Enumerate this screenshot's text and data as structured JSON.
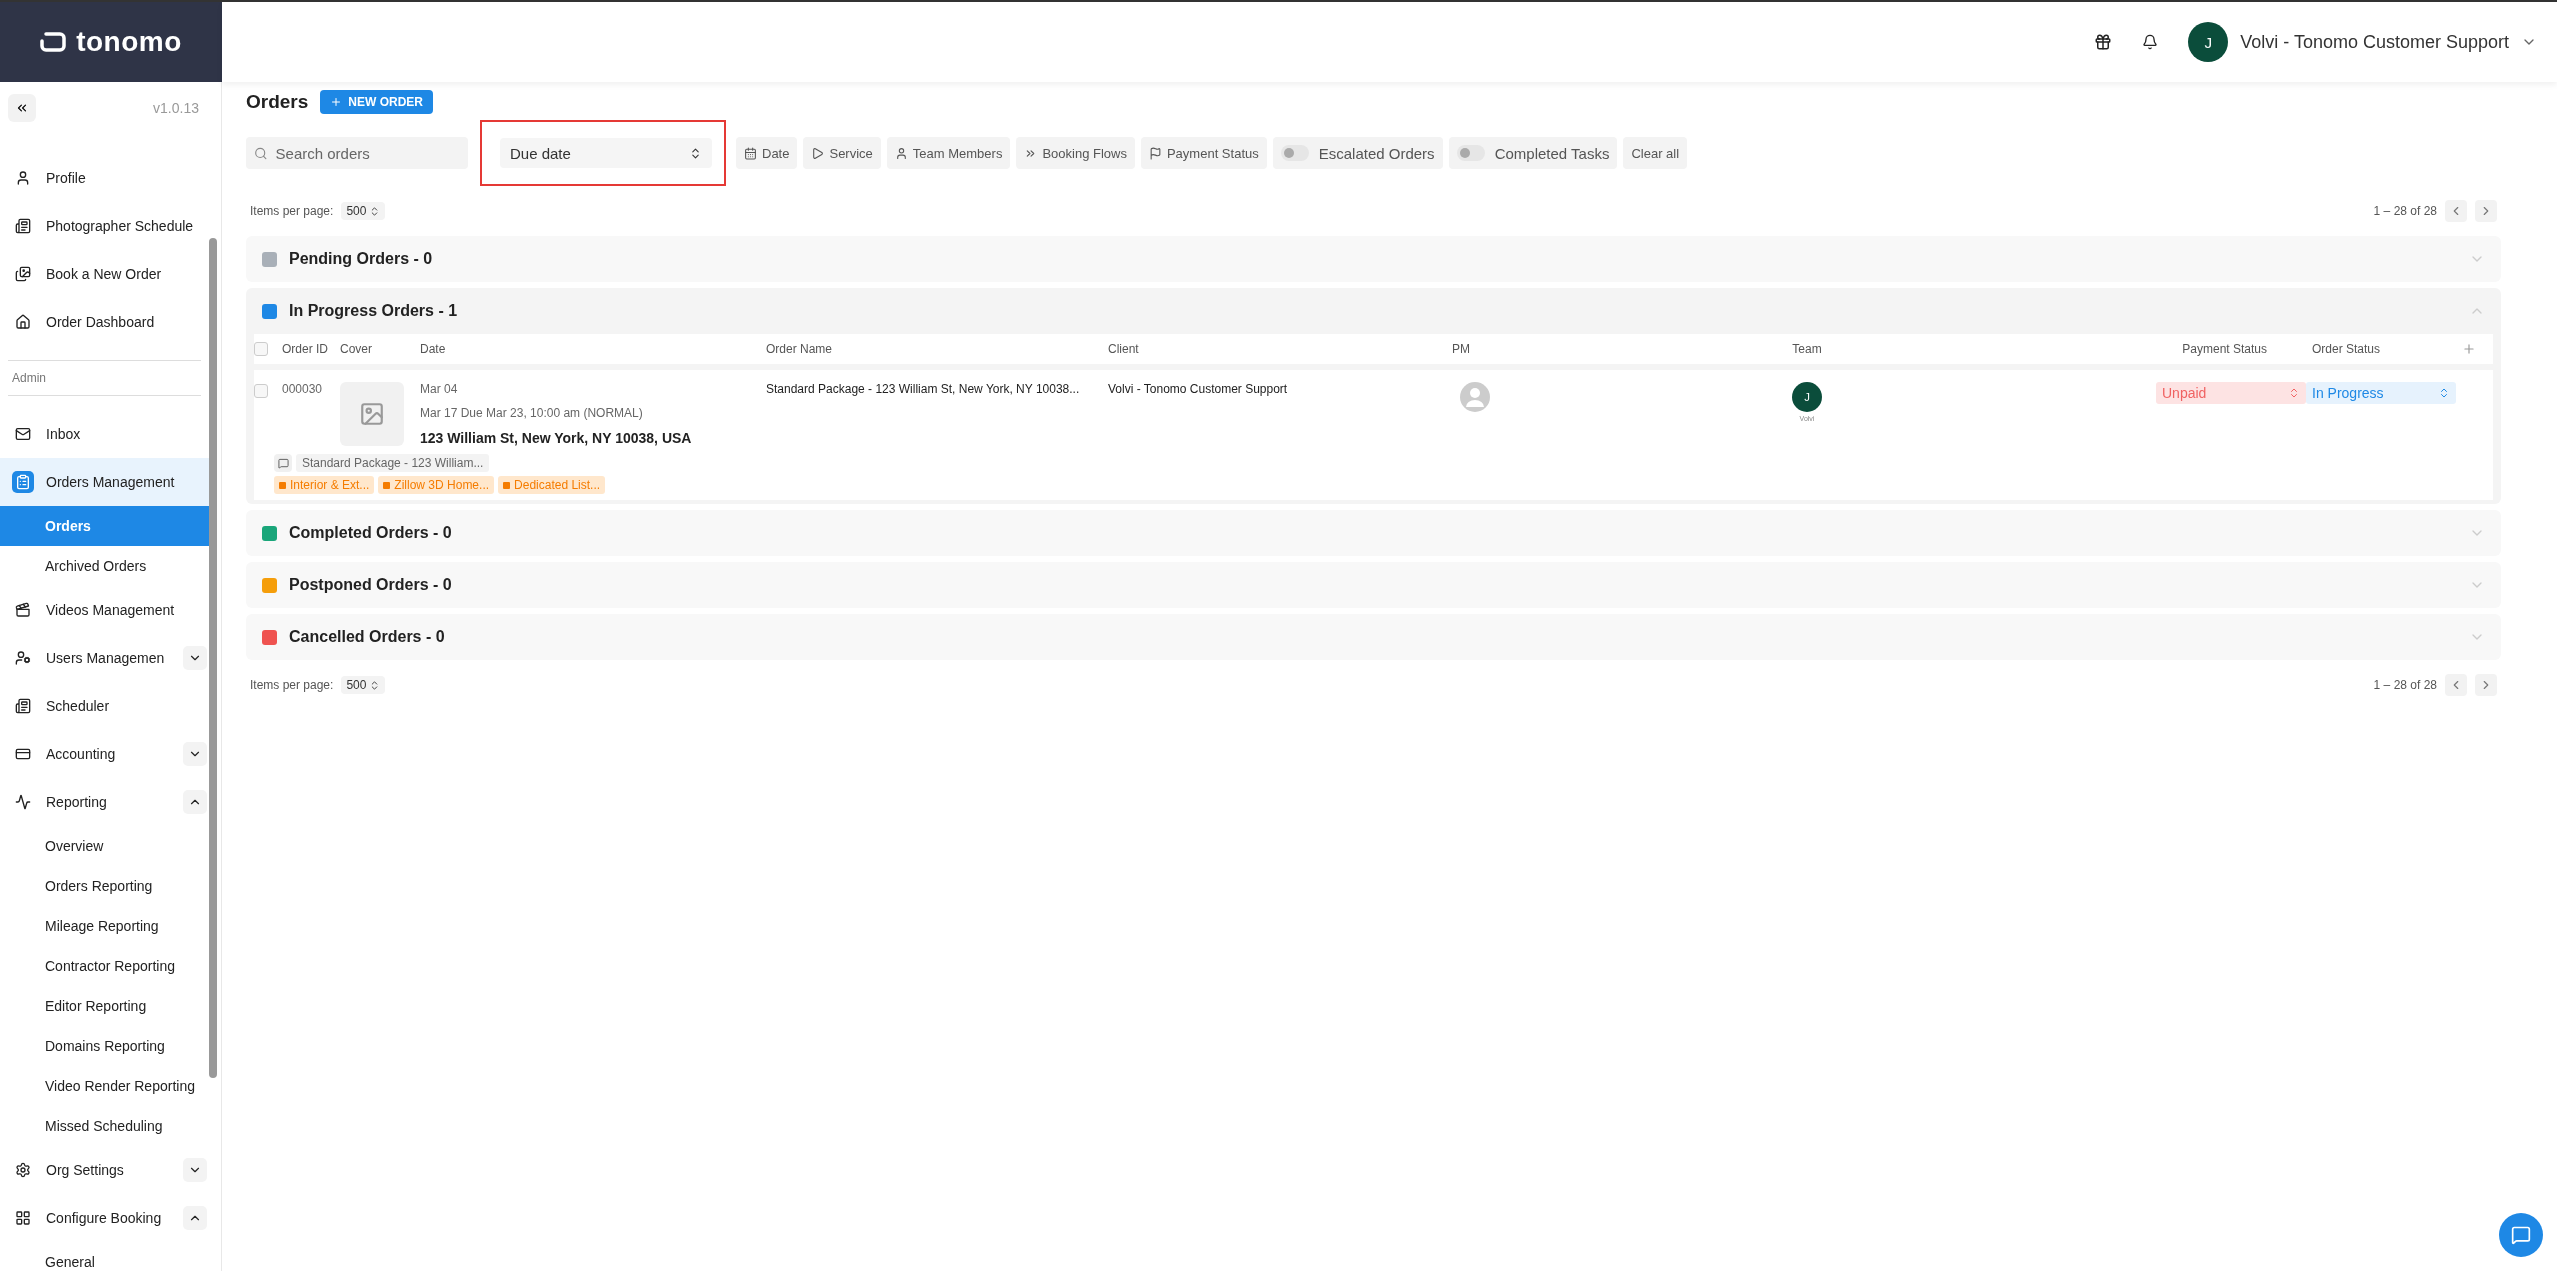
{
  "brand": {
    "name": "tonomo"
  },
  "header": {
    "user_initial": "J",
    "user_name": "Volvi - Tonomo Customer Support"
  },
  "sidebar": {
    "version": "v1.0.13",
    "items": [
      {
        "kind": "item",
        "label": "Profile",
        "selected": false
      },
      {
        "kind": "item",
        "label": "Photographer Schedule",
        "selected": false
      },
      {
        "kind": "item",
        "label": "Book a New Order",
        "selected": false
      },
      {
        "kind": "item",
        "label": "Order Dashboard",
        "selected": false
      },
      {
        "kind": "section",
        "label": "Admin"
      },
      {
        "kind": "item",
        "label": "Inbox",
        "selected": false
      },
      {
        "kind": "item",
        "label": "Orders Management",
        "selected": true,
        "children": [
          {
            "label": "Orders",
            "selected": true
          },
          {
            "label": "Archived Orders",
            "selected": false
          }
        ]
      },
      {
        "kind": "item",
        "label": "Videos Management",
        "selected": false
      },
      {
        "kind": "item",
        "label": "Users Managemen",
        "selected": false,
        "expanded": false
      },
      {
        "kind": "item",
        "label": "Scheduler",
        "selected": false
      },
      {
        "kind": "item",
        "label": "Accounting",
        "selected": false,
        "expanded": false
      },
      {
        "kind": "item",
        "label": "Reporting",
        "selected": false,
        "expanded": true,
        "children": [
          {
            "label": "Overview",
            "selected": false
          },
          {
            "label": "Orders Reporting",
            "selected": false
          },
          {
            "label": "Mileage Reporting",
            "selected": false
          },
          {
            "label": "Contractor Reporting",
            "selected": false
          },
          {
            "label": "Editor Reporting",
            "selected": false
          },
          {
            "label": "Domains Reporting",
            "selected": false
          },
          {
            "label": "Video Render Reporting",
            "selected": false
          },
          {
            "label": "Missed Scheduling",
            "selected": false
          }
        ]
      },
      {
        "kind": "item",
        "label": "Org Settings",
        "selected": false,
        "expanded": false
      },
      {
        "kind": "item",
        "label": "Configure Booking",
        "selected": false,
        "expanded": true,
        "children": [
          {
            "label": "General",
            "selected": false
          }
        ]
      }
    ]
  },
  "page": {
    "title": "Orders",
    "new_order": "NEW ORDER"
  },
  "toolbar": {
    "search": {
      "placeholder": "Search orders"
    },
    "sort": {
      "value": "Due date"
    },
    "filters": [
      {
        "kind": "button",
        "label": "Date"
      },
      {
        "kind": "button",
        "label": "Service"
      },
      {
        "kind": "button",
        "label": "Team Members"
      },
      {
        "kind": "button",
        "label": "Booking Flows"
      },
      {
        "kind": "button",
        "label": "Payment Status"
      },
      {
        "kind": "toggle",
        "label": "Escalated Orders",
        "on": false
      },
      {
        "kind": "toggle",
        "label": "Completed Tasks",
        "on": false
      },
      {
        "kind": "plain",
        "label": "Clear all"
      }
    ]
  },
  "pagination_top": {
    "label": "Items per page:",
    "value": "500",
    "range": "1 – 28 of 28"
  },
  "groups": [
    {
      "label": "Pending Orders - 0",
      "color": "#a9b0b8",
      "expanded": false
    },
    {
      "label": "In Progress Orders - 1",
      "color": "#1e88e5",
      "expanded": true
    },
    {
      "label": "Completed Orders - 0",
      "color": "#1aa67a",
      "expanded": false
    },
    {
      "label": "Postponed Orders - 0",
      "color": "#f59e0b",
      "expanded": false
    },
    {
      "label": "Cancelled Orders - 0",
      "color": "#ef5350",
      "expanded": false
    }
  ],
  "table": {
    "select_all_checked": false,
    "columns": [
      "Order ID",
      "Cover",
      "Date",
      "Order Name",
      "Client",
      "PM",
      "Team",
      "Payment Status",
      "Order Status"
    ],
    "rows": [
      {
        "checked": false,
        "order_id": "000030",
        "date": "Mar 04",
        "due": "Mar 17 Due Mar 23, 10:00 am (NORMAL)",
        "address": "123 William St, New York, NY 10038, USA",
        "order_name": "Standard Package - 123 William St, New York, NY 10038...",
        "client": "Volvi - Tonomo Customer Support",
        "team_initial": "J",
        "team_name": "Volvi",
        "payment_status": "Unpaid",
        "order_status": "In Progress",
        "note": "Standard Package - 123 William...",
        "tags": [
          "Interior & Ext...",
          "Zillow 3D Home...",
          "Dedicated List..."
        ]
      }
    ]
  },
  "pagination_bottom": {
    "label": "Items per page:",
    "value": "500",
    "range": "1 – 28 of 28"
  }
}
